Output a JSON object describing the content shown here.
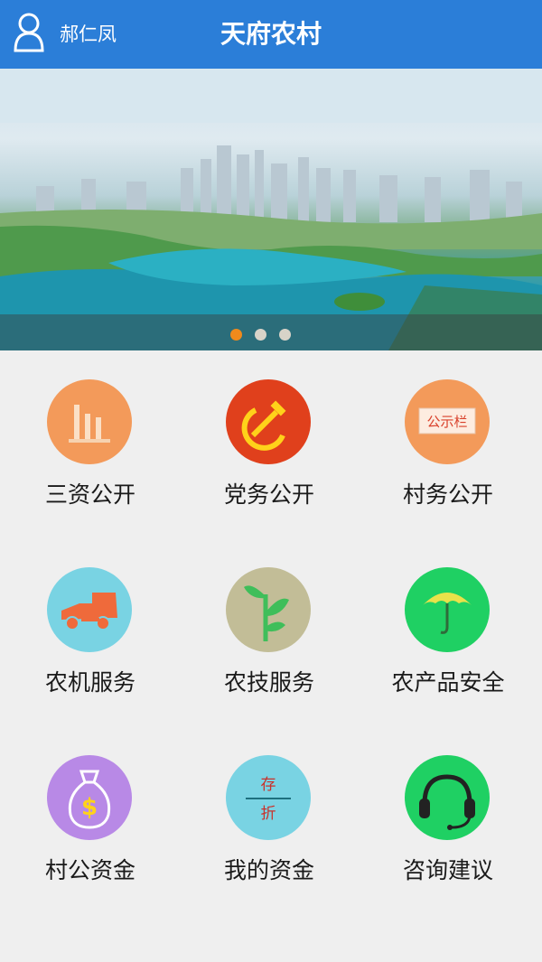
{
  "header": {
    "user_name": "郝仁凤",
    "title": "天府农村",
    "icon": "user-icon"
  },
  "banner": {
    "slide_count": 3,
    "active_slide": 1
  },
  "menu": [
    {
      "label": "三资公开",
      "icon": "bar-chart-icon",
      "color": "#f39a5a"
    },
    {
      "label": "党务公开",
      "icon": "hammer-sickle-icon",
      "color": "#e0401c"
    },
    {
      "label": "村务公开",
      "icon": "bulletin-board-icon",
      "color": "#f39a5a",
      "icon_text": "公示栏"
    },
    {
      "label": "农机服务",
      "icon": "tractor-icon",
      "color": "#79d3e3"
    },
    {
      "label": "农技服务",
      "icon": "seedling-icon",
      "color": "#c2bd97"
    },
    {
      "label": "农产品安全",
      "icon": "umbrella-icon",
      "color": "#1fd063"
    },
    {
      "label": "村公资金",
      "icon": "money-bag-icon",
      "color": "#b889e6"
    },
    {
      "label": "我的资金",
      "icon": "passbook-icon",
      "color": "#79d3e3",
      "icon_text_top": "存",
      "icon_text_bottom": "折"
    },
    {
      "label": "咨询建议",
      "icon": "headset-icon",
      "color": "#1fd063"
    }
  ]
}
